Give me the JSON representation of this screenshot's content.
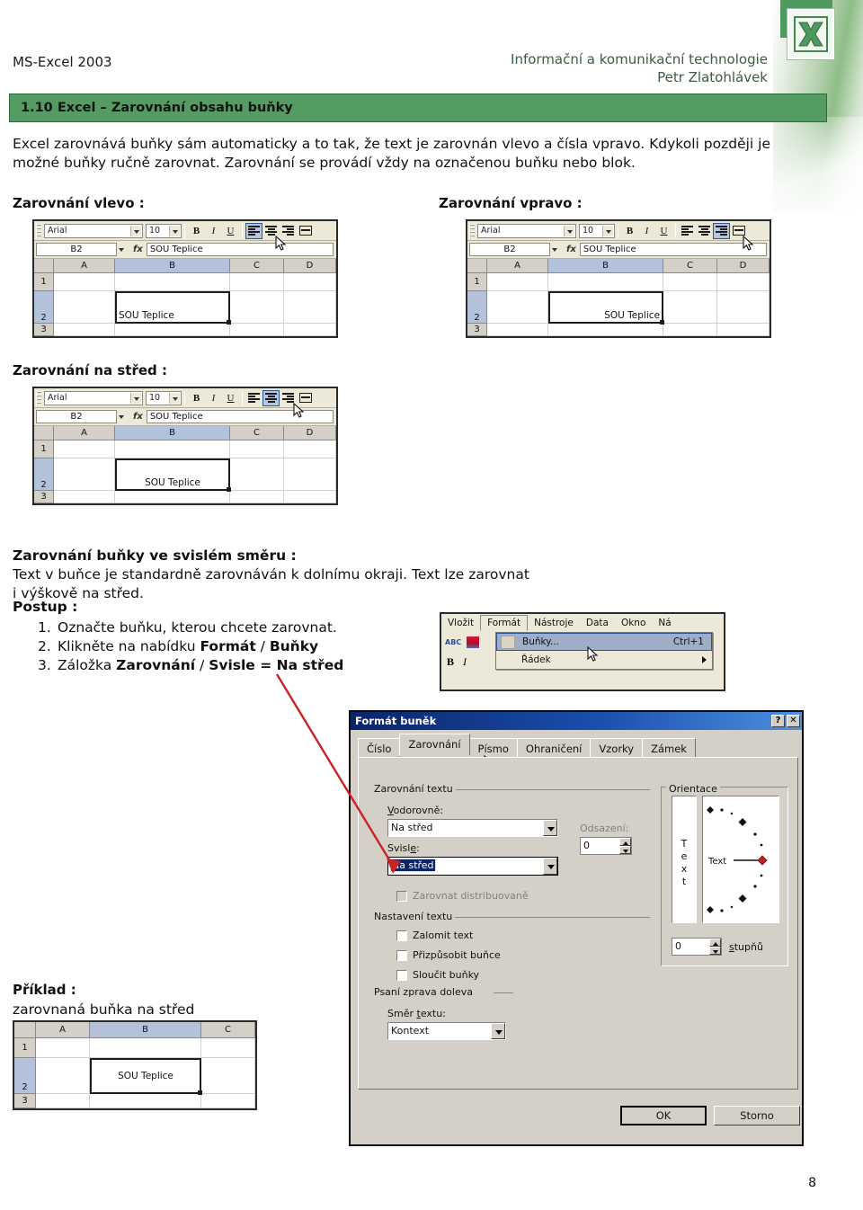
{
  "header": {
    "left_title": "MS-Excel 2003",
    "right_line1": "Informační a komunikační technologie",
    "right_line2": "Petr Zlatohlávek",
    "logo_icon": "excel-x-logo-icon"
  },
  "banner": {
    "title": "1.10 Excel – Zarovnání obsahu buňky",
    "color": "#549c63"
  },
  "intro": {
    "line1": "Excel zarovnává buňky sám automaticky a to tak, že text je zarovnán vlevo a čísla vpravo. Kdykoli později",
    "line2": "je možné buňky ručně zarovnat. Zarovnání se provádí vždy na označenou buňku nebo blok."
  },
  "captions": {
    "left": "Zarovnání vlevo :",
    "right": "Zarovnání vpravo :",
    "center": "Zarovnání na střed :",
    "example": "Příklad :",
    "example_sub": "zarovnaná buňka na střed"
  },
  "excel_shot": {
    "font_name": "Arial",
    "font_size": "10",
    "bold": "B",
    "italic": "I",
    "underline": "U",
    "name_box": "B2",
    "fx": "fx",
    "formula": "SOU Teplice",
    "columns": [
      "A",
      "B",
      "C",
      "D"
    ],
    "columns_example": [
      "A",
      "B",
      "C"
    ],
    "rows": [
      "1",
      "2",
      "3"
    ],
    "cell_value": "SOU Teplice",
    "selected_cell": "B2",
    "align_buttons": [
      "align-left",
      "align-center",
      "align-right",
      "merge-center"
    ]
  },
  "vertical_section": {
    "heading": "Zarovnání buňky ve svislém směru :",
    "body": "Text v buňce je standardně zarovnáván k dolnímu okraji. Text lze zarovnat i výškově na střed.",
    "postup_label": "Postup :",
    "steps": [
      {
        "num": "1.",
        "pre": "Označte buňku, kterou chcete zarovnat.",
        "bold1": "",
        "mid": "",
        "bold2": ""
      },
      {
        "num": "2.",
        "pre": "Klikněte na nabídku ",
        "bold1": "Formát",
        "mid": " / ",
        "bold2": "Buňky"
      },
      {
        "num": "3.",
        "pre": "Záložka ",
        "bold1": "Zarovnání",
        "mid": " / ",
        "bold2": "Svisle = Na střed"
      }
    ]
  },
  "menu_shot": {
    "items": [
      "Vložit",
      "Formát",
      "Nástroje",
      "Data",
      "Okno",
      "Ná"
    ],
    "selected_item": "Formát",
    "dropdown": [
      {
        "label": "Buňky...",
        "shortcut": "Ctrl+1",
        "highlighted": true,
        "submenu": false
      },
      {
        "label": "Řádek",
        "shortcut": "",
        "highlighted": false,
        "submenu": true
      }
    ],
    "toolbar_glyphs": [
      "ABC",
      "B",
      "I"
    ]
  },
  "dialog": {
    "title": "Formát buněk",
    "help_button": "?",
    "close_button": "✕",
    "tabs": [
      "Číslo",
      "Zarovnání",
      "Písmo",
      "Ohraničení",
      "Vzorky",
      "Zámek"
    ],
    "active_tab": "Zarovnání",
    "group_text_align": "Zarovnání textu",
    "label_horizontal": "Vodorovně:",
    "value_horizontal": "Na střed",
    "label_vertical": "Svisle:",
    "value_vertical": "Na střed",
    "label_indent": "Odsazení:",
    "value_indent": "0",
    "checkbox_distributed": "Zarovnat distribuovaně",
    "group_text_settings": "Nastavení textu",
    "checkbox_wrap": "Zalomit text",
    "checkbox_shrink": "Přizpůsobit buňce",
    "checkbox_merge": "Sloučit buňky",
    "group_rtl": "Psaní zprava doleva",
    "label_direction": "Směr textu:",
    "value_direction": "Kontext",
    "group_orientation": "Orientace",
    "vertical_text_letters": [
      "T",
      "e",
      "x",
      "t"
    ],
    "dial_text": "Text",
    "degrees_value": "0",
    "degrees_label": "stupňů",
    "ok_button": "OK",
    "cancel_button": "Storno"
  },
  "page_number": "8",
  "colors": {
    "banner_green": "#549c63",
    "header_green_text": "#3d5b40",
    "arrow_red": "#cc2222",
    "dialog_title_blue": "#0a246a",
    "selection_blue": "#b3c2da"
  }
}
